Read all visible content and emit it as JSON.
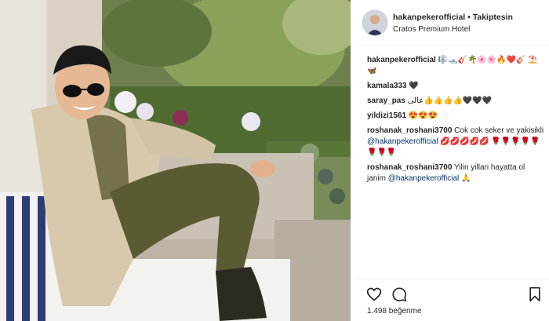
{
  "header": {
    "username": "hakanpekerofficial",
    "separator": "•",
    "follow_status": "Takiptesin",
    "location": "Cratos Premium Hotel"
  },
  "comments": [
    {
      "user": "hakanpekerofficial",
      "text": "🎼🛥️🎸🌴🌸🌸🔥❤️🎸 ⛱️🦋"
    },
    {
      "user": "kamala333",
      "text": "🖤"
    },
    {
      "user": "saray_pas",
      "text": "عالی👍👍👍👍🖤🖤🖤"
    },
    {
      "user": "yildizi1561",
      "text": "😍😍😍"
    },
    {
      "user": "roshanak_roshani3700",
      "text": "Cok cok seker ve yakisikli",
      "mention": "@hakanpekerofficial",
      "tail": "💋💋💋💋💋 🌹🌹🌹🌹🌹🌹🌹🌹"
    },
    {
      "user": "roshanak_roshani3700",
      "text": "Yilin yillari hayatta ol janim",
      "mention": "@hakanpekerofficial",
      "tail": "🙏"
    }
  ],
  "likes": {
    "count_text": "1.498 beğenme"
  },
  "icons": {
    "like": "heart-icon",
    "comment": "comment-icon",
    "save": "bookmark-icon"
  },
  "colors": {
    "text": "#262626",
    "mention": "#003569",
    "divider": "#efefef"
  }
}
